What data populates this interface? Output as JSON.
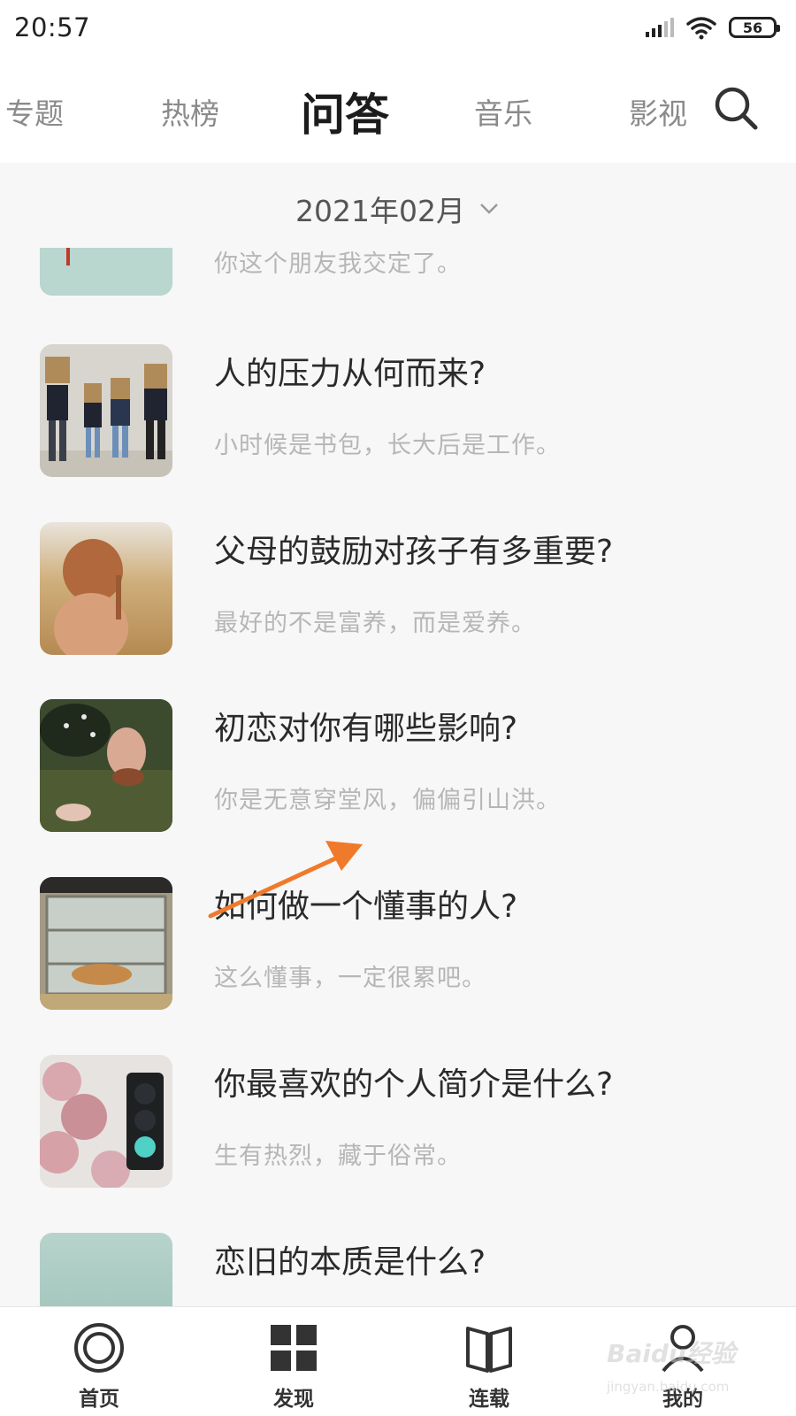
{
  "status_bar": {
    "time": "20:57",
    "battery": "56",
    "icons": [
      "signal-icon",
      "wifi-icon",
      "battery-icon"
    ]
  },
  "top_nav": {
    "tabs": [
      {
        "label": "专题",
        "active": false
      },
      {
        "label": "热榜",
        "active": false
      },
      {
        "label": "问答",
        "active": true
      },
      {
        "label": "音乐",
        "active": false
      },
      {
        "label": "影视",
        "active": false
      }
    ],
    "search_icon": "search-icon"
  },
  "month_selector": {
    "label": "2021年02月",
    "icon": "chevron-down-icon"
  },
  "items": [
    {
      "title": "",
      "subtitle": "你这个朋友我交定了。"
    },
    {
      "title": "人的压力从何而来?",
      "subtitle": "小时候是书包，长大后是工作。"
    },
    {
      "title": "父母的鼓励对孩子有多重要?",
      "subtitle": "最好的不是富养，而是爱养。"
    },
    {
      "title": "初恋对你有哪些影响?",
      "subtitle": "你是无意穿堂风，偏偏引山洪。"
    },
    {
      "title": "如何做一个懂事的人?",
      "subtitle": "这么懂事，一定很累吧。"
    },
    {
      "title": "你最喜欢的个人简介是什么?",
      "subtitle": "生有热烈，藏于俗常。"
    },
    {
      "title": "恋旧的本质是什么?",
      "subtitle": ""
    }
  ],
  "annotation": {
    "arrow_color": "#f07a2c"
  },
  "bottom_nav": {
    "items": [
      {
        "label": "首页",
        "icon": "home-ring-icon"
      },
      {
        "label": "发现",
        "icon": "grid-icon"
      },
      {
        "label": "连载",
        "icon": "book-icon"
      },
      {
        "label": "我的",
        "icon": "user-icon"
      }
    ]
  },
  "watermark": {
    "text": "Baidu经验",
    "sub": "jingyan.baidu.com"
  }
}
